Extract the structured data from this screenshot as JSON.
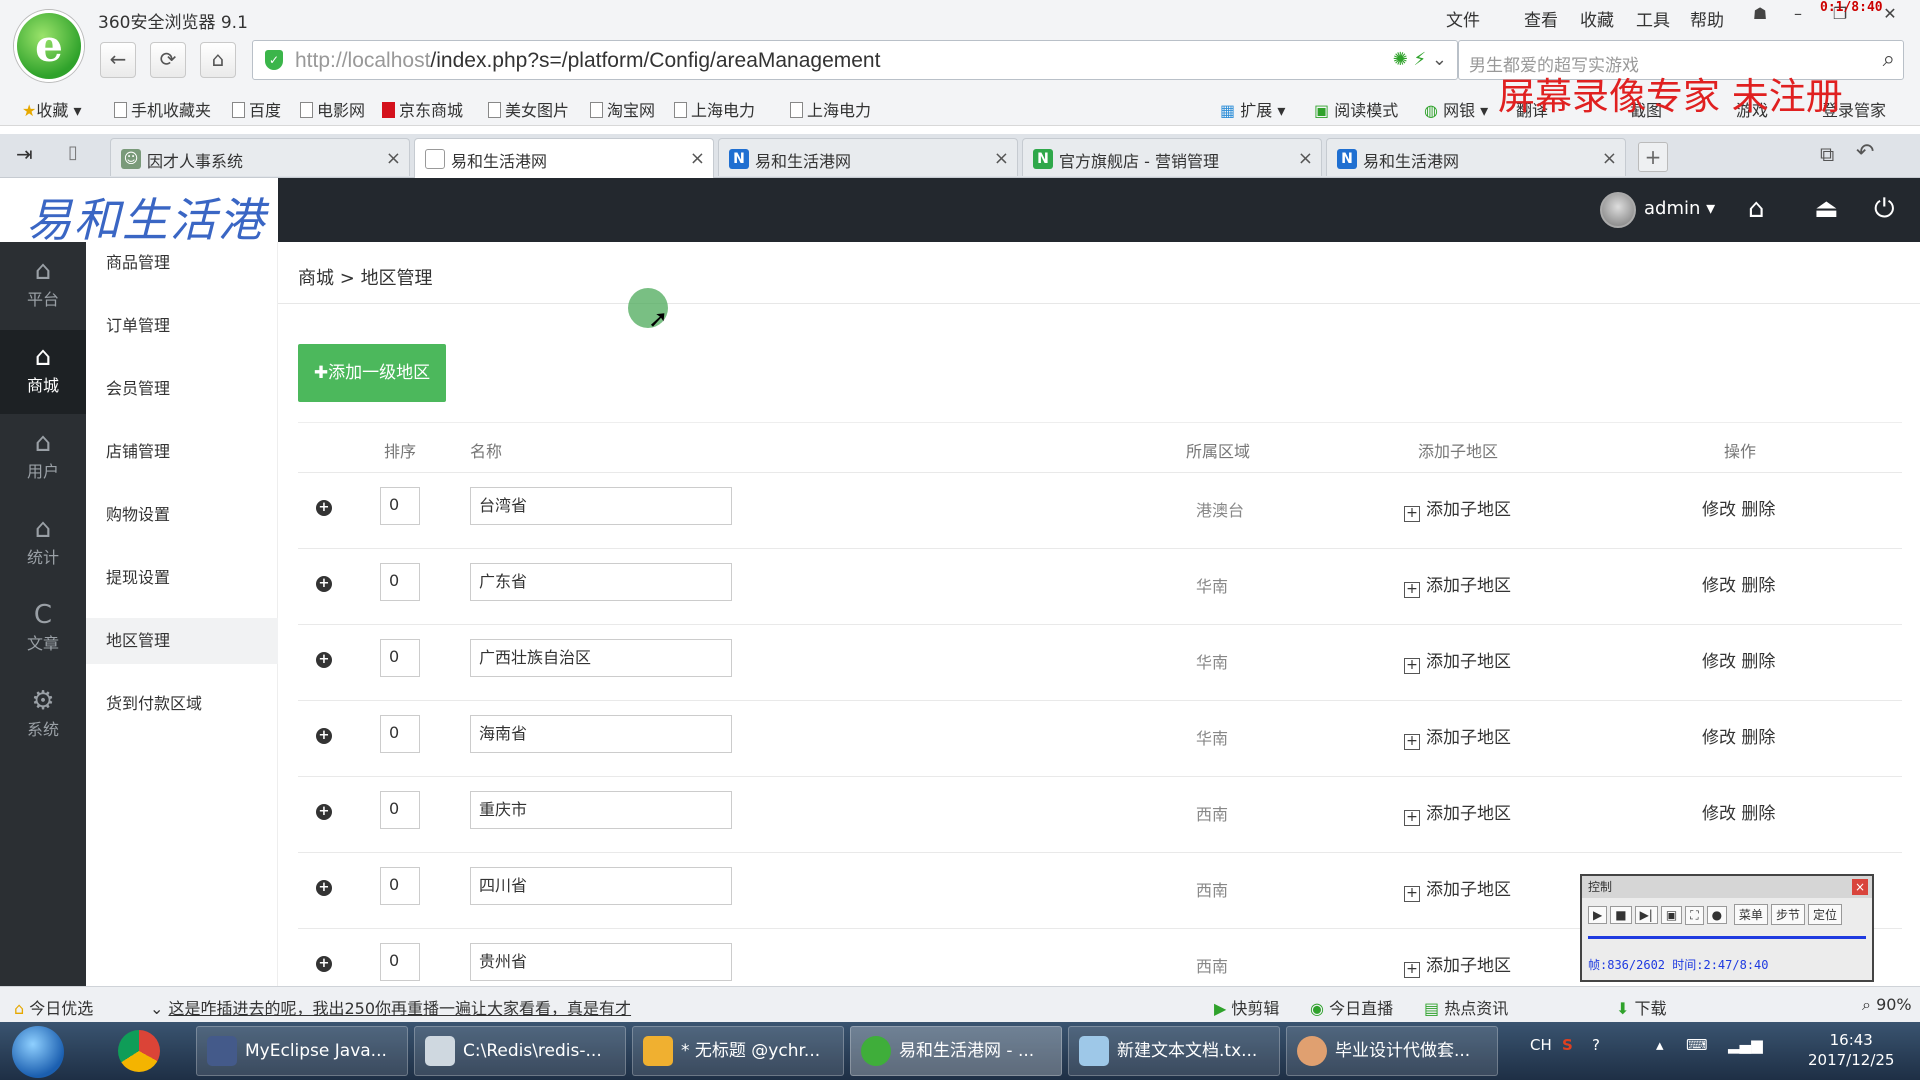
{
  "browser": {
    "app_title": "360安全浏览器 9.1",
    "menu": [
      "文件",
      "查看",
      "收藏",
      "工具",
      "帮助"
    ],
    "recording_timer": "0:1/8:40",
    "url_host": "http://localhost",
    "url_path": "/index.php?s=/platform/Config/areaManagement",
    "search_placeholder": "男生都爱的超写实游戏",
    "watermark": "屏幕录像专家  未注册",
    "bookmarks": [
      "收藏",
      "手机收藏夹",
      "百度",
      "电影网",
      "京东商城",
      "美女图片",
      "淘宝网",
      "上海电力",
      "上海电力"
    ],
    "toolbar_right": [
      "扩展",
      "阅读模式",
      "网银",
      "翻译",
      "截图",
      "游戏",
      "登录管家"
    ],
    "tabs": [
      {
        "label": "因才人事系统",
        "color": "#7a9a7a"
      },
      {
        "label": "易和生活港网",
        "color": "#ffffff"
      },
      {
        "label": "易和生活港网",
        "color": "#1f6fd1"
      },
      {
        "label": "官方旗舰店 - 营销管理",
        "color": "#2fa84a"
      },
      {
        "label": "易和生活港网",
        "color": "#1f6fd1"
      }
    ]
  },
  "app": {
    "brand": "易和生活港",
    "user": "admin",
    "left_nav": [
      {
        "icon": "home-icon",
        "label": "平台"
      },
      {
        "icon": "home-icon",
        "label": "商城"
      },
      {
        "icon": "home-icon",
        "label": "用户"
      },
      {
        "icon": "home-icon",
        "label": "统计"
      },
      {
        "icon": "c-icon",
        "label": "文章"
      },
      {
        "icon": "gear-icon",
        "label": "系统"
      }
    ],
    "sub_nav": [
      "商品管理",
      "订单管理",
      "会员管理",
      "店铺管理",
      "购物设置",
      "提现设置",
      "地区管理",
      "货到付款区域"
    ],
    "breadcrumb": {
      "root": "商城",
      "sep": ">",
      "current": "地区管理"
    },
    "add_button": "添加一级地区",
    "table_headers": [
      "排序",
      "名称",
      "所属区域",
      "添加子地区",
      "操作"
    ],
    "rows": [
      {
        "sort": "0",
        "name": "台湾省",
        "region": "港澳台"
      },
      {
        "sort": "0",
        "name": "广东省",
        "region": "华南"
      },
      {
        "sort": "0",
        "name": "广西壮族自治区",
        "region": "华南"
      },
      {
        "sort": "0",
        "name": "海南省",
        "region": "华南"
      },
      {
        "sort": "0",
        "name": "重庆市",
        "region": "西南"
      },
      {
        "sort": "0",
        "name": "四川省",
        "region": "西南"
      },
      {
        "sort": "0",
        "name": "贵州省",
        "region": "西南"
      }
    ],
    "add_sub_label": "添加子地区",
    "edit_label": "修改",
    "delete_label": "删除"
  },
  "recorder": {
    "title": "控制",
    "buttons": [
      "菜单",
      "步节",
      "定位"
    ],
    "info": "帧:836/2602 时间:2:47/8:40"
  },
  "statusbar": {
    "left": "今日优选",
    "news": "这是咋插进去的呢，我出250你再重播一遍让大家看看，真是有才",
    "items": [
      "快剪辑",
      "今日直播",
      "热点资讯",
      "下载"
    ],
    "zoom": "90%"
  },
  "taskbar": {
    "tasks": [
      "MyEclipse Java...",
      "C:\\Redis\\redis-...",
      "* 无标题 @ychr...",
      "易和生活港网 - ...",
      "新建文本文档.tx...",
      "毕业设计代做套..."
    ],
    "lang": "CH",
    "time": "16:43",
    "date": "2017/12/25"
  }
}
